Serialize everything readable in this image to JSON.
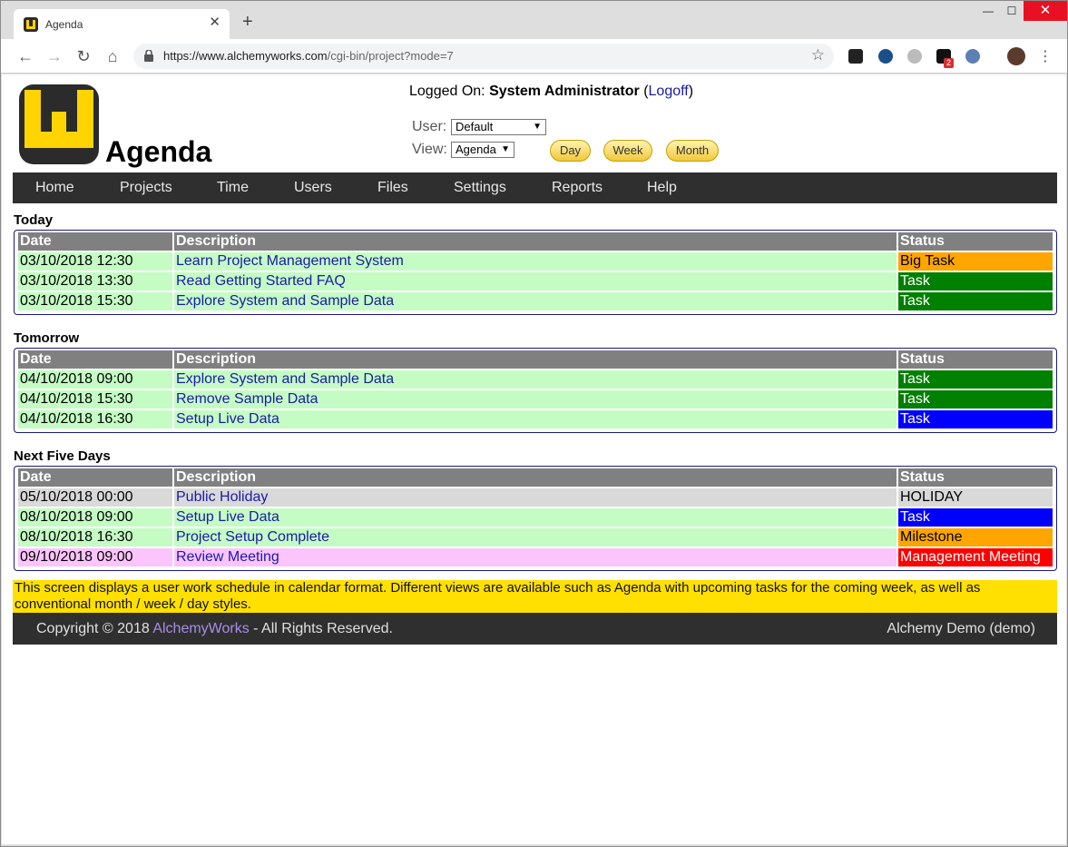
{
  "browser": {
    "tab_title": "Agenda",
    "url_host": "https://www.alchemyworks.com",
    "url_path": "/cgi-bin/project?mode=7",
    "extension_badge": "2"
  },
  "header": {
    "site_title": "Agenda",
    "logged_on_label": "Logged On:",
    "user_name": "System Administrator",
    "logoff_label": "Logoff",
    "user_label": "User:",
    "user_value": "Default",
    "view_label": "View:",
    "view_value": "Agenda",
    "day_label": "Day",
    "week_label": "Week",
    "month_label": "Month"
  },
  "nav": [
    "Home",
    "Projects",
    "Time",
    "Users",
    "Files",
    "Settings",
    "Reports",
    "Help"
  ],
  "columns": {
    "date": "Date",
    "description": "Description",
    "status": "Status"
  },
  "sections": [
    {
      "title": "Today",
      "rows": [
        {
          "date": "03/10/2018 12:30",
          "desc": "Learn Project Management System",
          "status": "Big Task",
          "row_color": "green",
          "status_bg": "#ffa500",
          "status_fg": "#000000"
        },
        {
          "date": "03/10/2018 13:30",
          "desc": "Read Getting Started FAQ",
          "status": "Task",
          "row_color": "green",
          "status_bg": "#008000",
          "status_fg": "#ffffff"
        },
        {
          "date": "03/10/2018 15:30",
          "desc": "Explore System and Sample Data",
          "status": "Task",
          "row_color": "green",
          "status_bg": "#008000",
          "status_fg": "#ffffff"
        }
      ]
    },
    {
      "title": "Tomorrow",
      "rows": [
        {
          "date": "04/10/2018 09:00",
          "desc": "Explore System and Sample Data",
          "status": "Task",
          "row_color": "green",
          "status_bg": "#008000",
          "status_fg": "#ffffff"
        },
        {
          "date": "04/10/2018 15:30",
          "desc": "Remove Sample Data",
          "status": "Task",
          "row_color": "green",
          "status_bg": "#008000",
          "status_fg": "#ffffff"
        },
        {
          "date": "04/10/2018 16:30",
          "desc": "Setup Live Data",
          "status": "Task",
          "row_color": "green",
          "status_bg": "#0000ff",
          "status_fg": "#ffffff"
        }
      ]
    },
    {
      "title": "Next Five Days",
      "rows": [
        {
          "date": "05/10/2018 00:00",
          "desc": "Public Holiday",
          "status": "HOLIDAY",
          "row_color": "grey",
          "status_bg": "#d9d9d9",
          "status_fg": "#000000"
        },
        {
          "date": "08/10/2018 09:00",
          "desc": "Setup Live Data",
          "status": "Task",
          "row_color": "green",
          "status_bg": "#0000ff",
          "status_fg": "#ffffff"
        },
        {
          "date": "08/10/2018 16:30",
          "desc": "Project Setup Complete",
          "status": "Milestone",
          "row_color": "green",
          "status_bg": "#ffa500",
          "status_fg": "#000000"
        },
        {
          "date": "09/10/2018 09:00",
          "desc": "Review Meeting",
          "status": "Management Meeting",
          "row_color": "pink",
          "status_bg": "#ff0000",
          "status_fg": "#ffffff"
        }
      ]
    }
  ],
  "info_text": "This screen displays a user work schedule in calendar format. Different views are available such as Agenda with upcoming tasks for the coming week, as well as conventional month / week / day styles.",
  "footer": {
    "copyright_prefix": "Copyright © 2018",
    "company_link": "AlchemyWorks",
    "copyright_suffix": "- All Rights Reserved.",
    "demo_label": "Alchemy Demo (demo)"
  }
}
